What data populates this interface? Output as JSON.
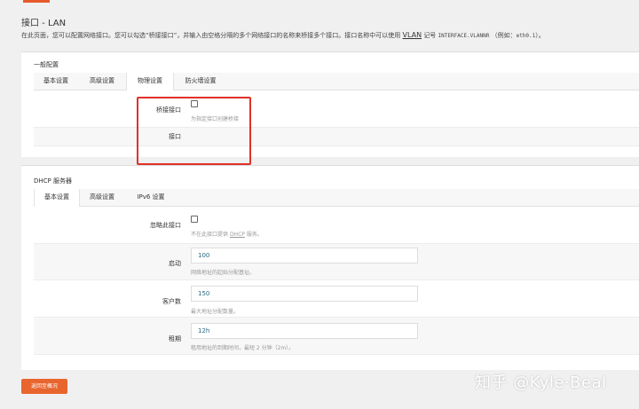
{
  "page": {
    "title": "接口 - LAN",
    "description": {
      "part1": "在此页面，您可以配置网络接口。您可以勾选“桥接接口”，并输入由空格分隔的多个网络接口的名称来桥接多个接口。接口名称中可以使用",
      "vlan": "VLAN",
      "part2": "记号",
      "code1": "INTERFACE.VLANNR",
      "part3": "（例如：",
      "code2": "eth0.1",
      "part4": "）。"
    }
  },
  "general": {
    "title": "一般配置",
    "tabs": [
      "基本设置",
      "高级设置",
      "物理设置",
      "防火墙设置"
    ],
    "bridge_label": "桥接接口",
    "bridge_hint": "为指定接口创建桥接",
    "interface_label": "接口"
  },
  "dhcp": {
    "title": "DHCP 服务器",
    "tabs": [
      "基本设置",
      "高级设置",
      "IPv6 设置"
    ],
    "ignore_label": "忽略此接口",
    "ignore_hint_pre": "不在此接口提供",
    "ignore_hint_link": "DHCP",
    "ignore_hint_post": "服务。",
    "start_label": "启动",
    "start_value": "100",
    "start_hint": "网络地址的起始分配基址。",
    "limit_label": "客户数",
    "limit_value": "150",
    "limit_hint": "最大地址分配数量。",
    "lease_label": "租期",
    "lease_value": "12h",
    "lease_hint": "租用地址的到期时间，最短 2 分钟（2m）。"
  },
  "footer": {
    "back_label": "返回至概况"
  },
  "watermark": "知乎 @Kyle·Beal",
  "colors": {
    "accent": "#e8652e",
    "highlight": "#e0312a"
  }
}
